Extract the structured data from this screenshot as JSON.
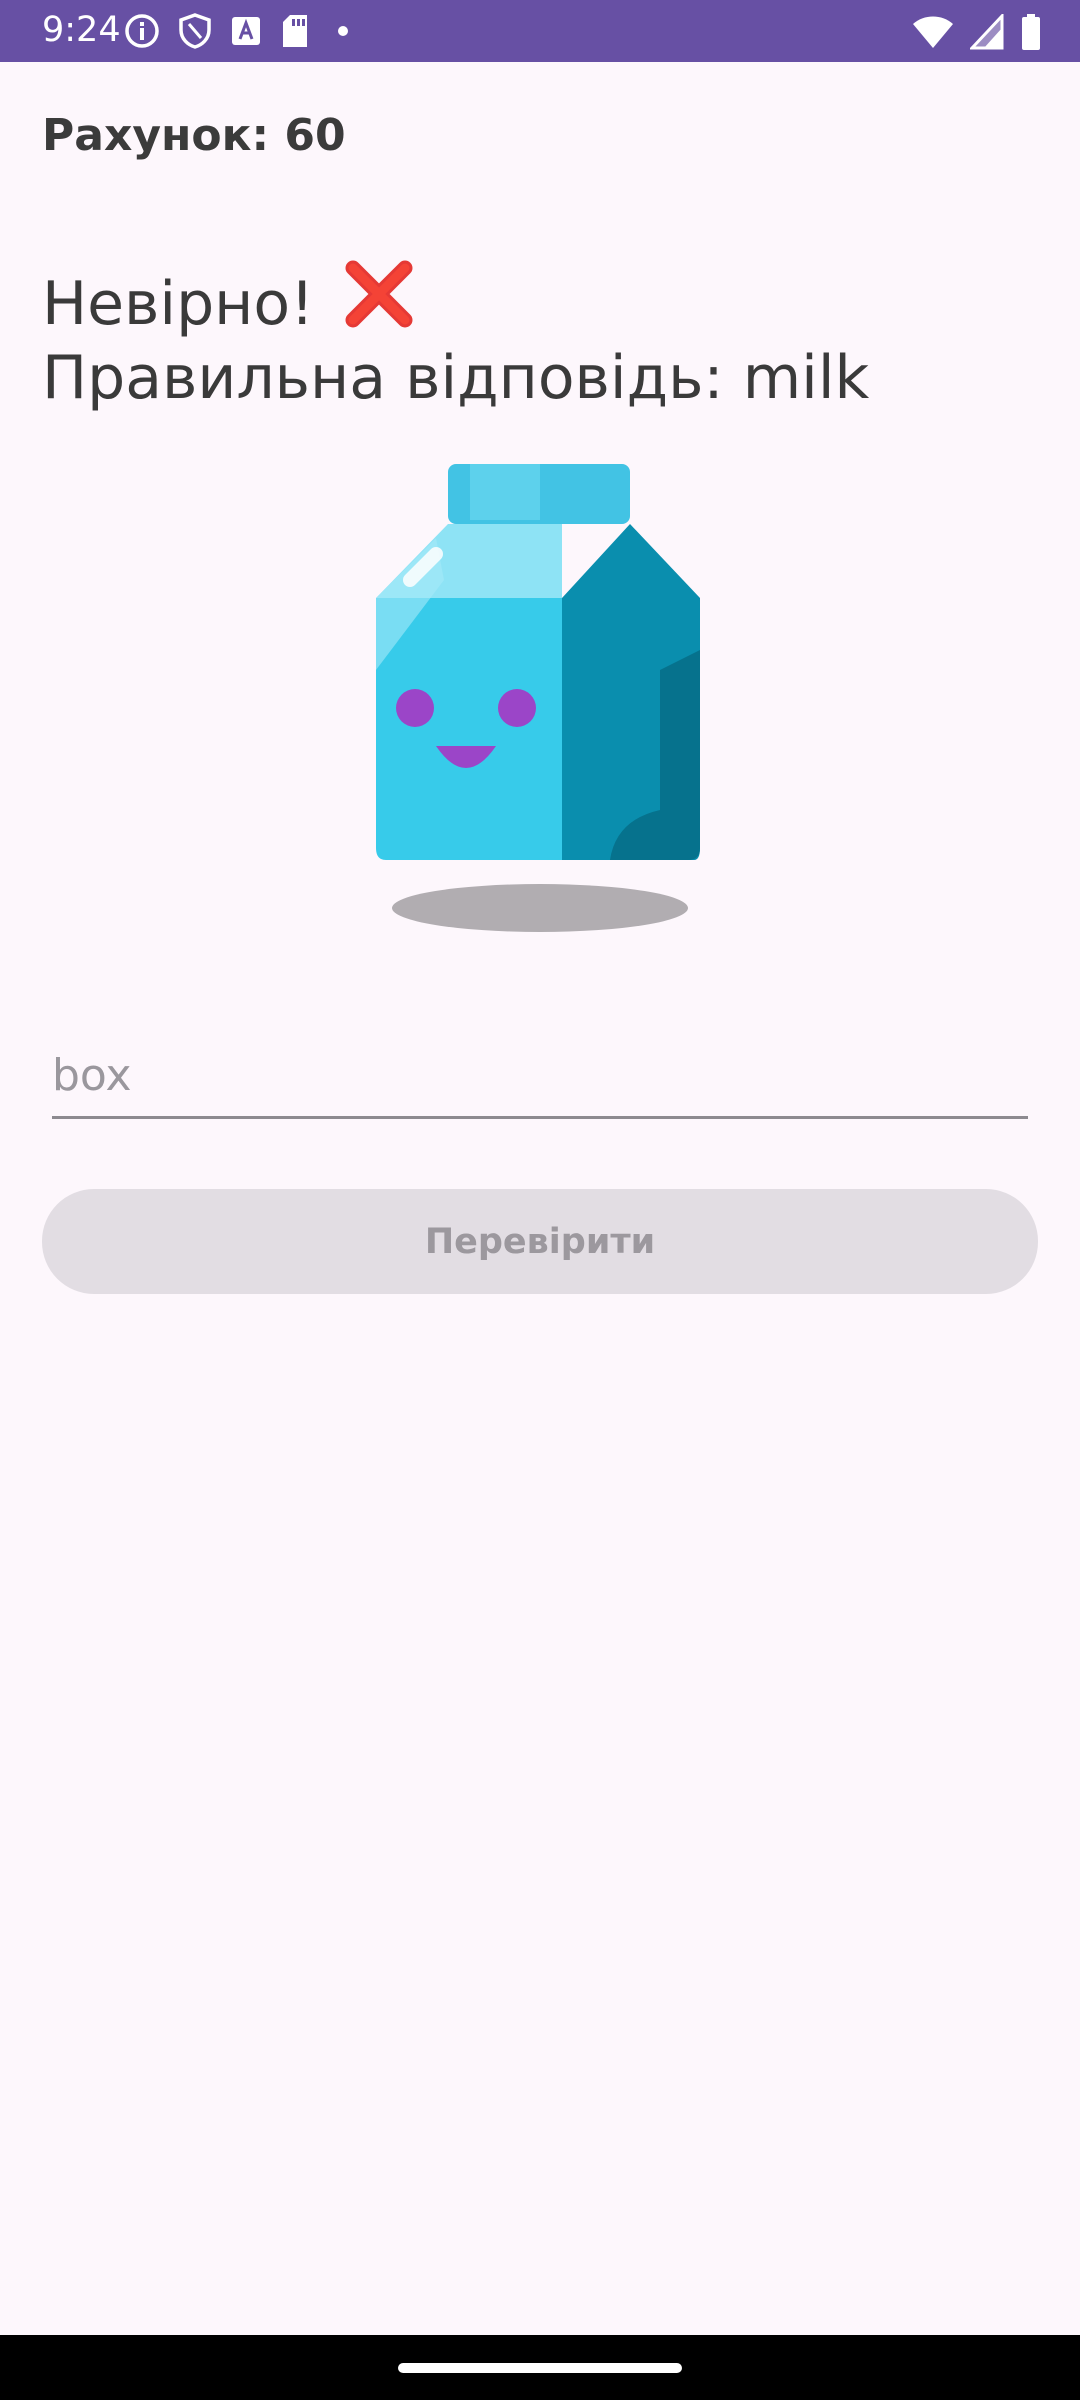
{
  "status_bar": {
    "time": "9:24",
    "background_color": "#6750a4",
    "left_icons": [
      "info-icon",
      "shield-icon",
      "font-download-icon",
      "sd-card-icon",
      "dot-icon"
    ],
    "right_icons": [
      "wifi-icon",
      "signal-icon",
      "battery-icon"
    ]
  },
  "score": {
    "label": "Рахунок: 60"
  },
  "result": {
    "status_text": "Невірно! ",
    "status_icon": "red-cross-mark-icon",
    "correct_answer_text": "Правильна відповідь: milk"
  },
  "illustration": {
    "icon": "milk-carton-icon",
    "colors": {
      "carton_front": "#37cbea",
      "carton_side": "#0a8eae",
      "face": "#9b45c8"
    }
  },
  "answer_input": {
    "placeholder": "box",
    "value": ""
  },
  "check_button": {
    "label": "Перевірити",
    "enabled": false
  },
  "theme": {
    "background": "#fdf7fc",
    "accent": "#6750a4",
    "button_disabled_bg": "#e2dde3"
  }
}
